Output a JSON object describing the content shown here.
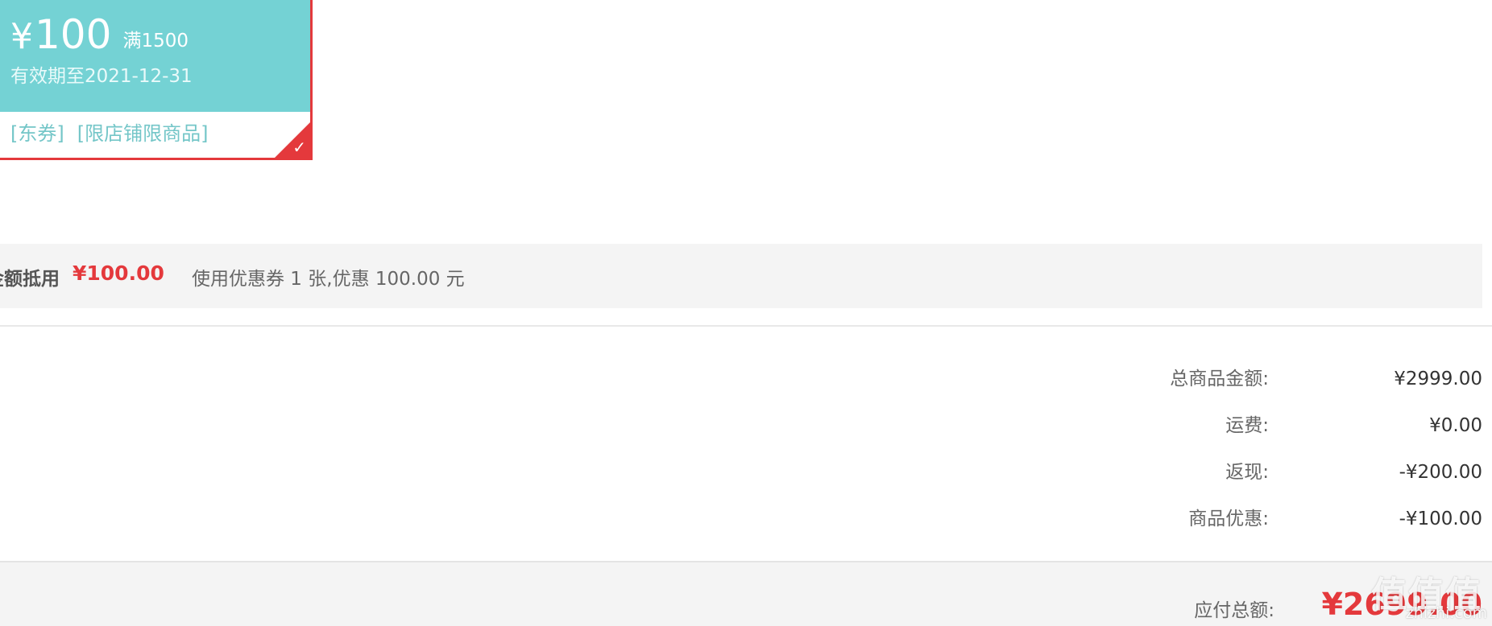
{
  "coupon": {
    "currency": "¥",
    "value": "100",
    "limit": "满1500",
    "validity": "有效期至2021-12-31",
    "tags": [
      "[东券]",
      "[限店铺限商品]"
    ],
    "selected": true,
    "accent_color": "#74d2d4",
    "selected_border_color": "#e4393c"
  },
  "discount_bar": {
    "label": "金额抵用",
    "amount": "¥100.00",
    "description": "使用优惠券 1 张,优惠 100.00 元"
  },
  "summary": [
    {
      "label": "总商品金额:",
      "value": "¥2999.00"
    },
    {
      "label": "运费:",
      "value": "¥0.00"
    },
    {
      "label": "返现:",
      "value": "-¥200.00"
    },
    {
      "label": "商品优惠:",
      "value": "-¥100.00"
    }
  ],
  "total": {
    "label": "应付总额:",
    "value": "¥2699.00",
    "color": "#e4393c"
  },
  "watermark": {
    "logo": "值值值",
    "url": "zhizhi.com"
  }
}
